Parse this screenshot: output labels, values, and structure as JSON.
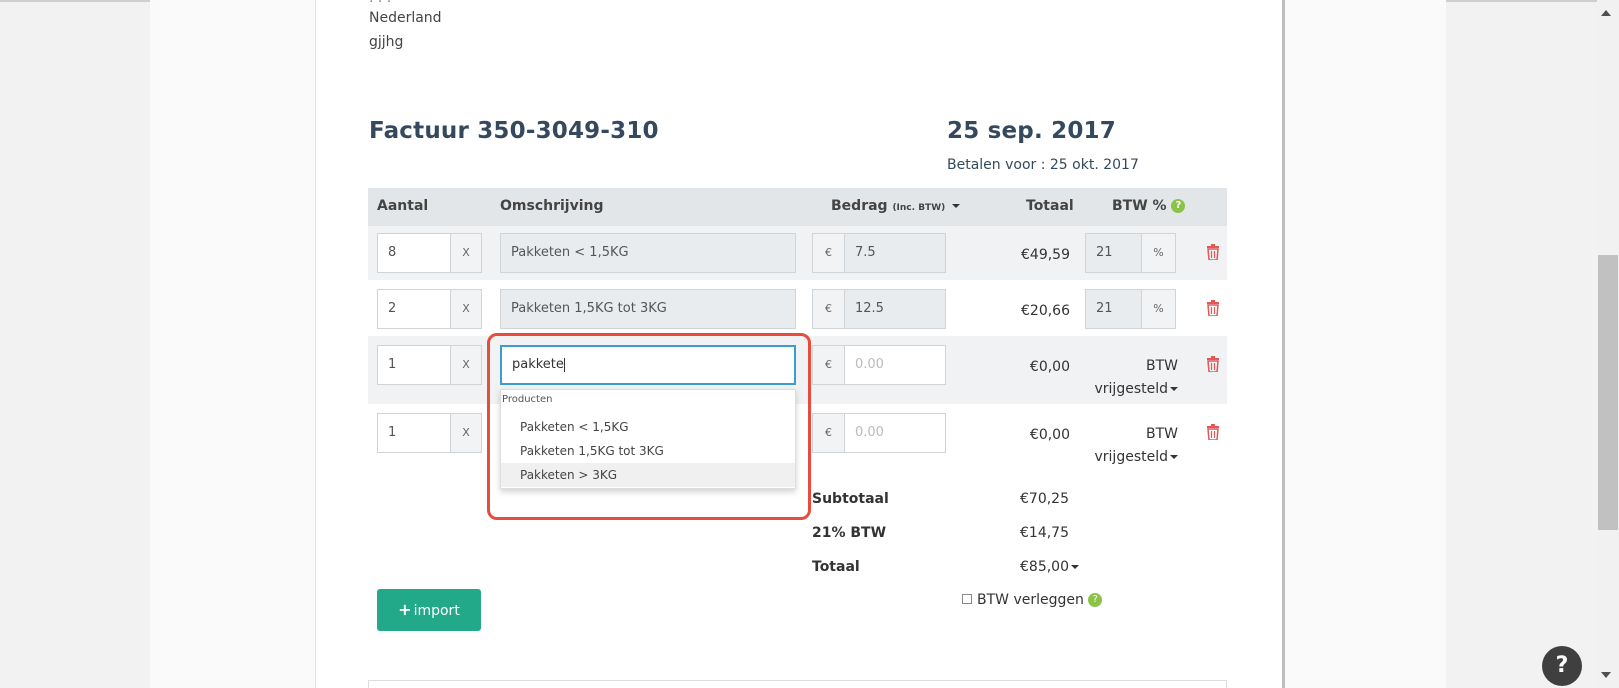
{
  "address": {
    "country": "Nederland",
    "extra": "gjjhg"
  },
  "invoice": {
    "title": "Factuur 350-3049-310",
    "date": "25 sep. 2017",
    "due": "Betalen voor : 25 okt. 2017"
  },
  "table": {
    "headers": {
      "aantal": "Aantal",
      "omschrijving": "Omschrijving",
      "bedrag": "Bedrag",
      "bedrag_note": "(Inc. BTW)",
      "totaal": "Totaal",
      "btw": "BTW %",
      "help": "?"
    },
    "x_label": "X",
    "euro": "€",
    "percent": "%",
    "rows": [
      {
        "qty": "8",
        "desc": "Pakketen < 1,5KG",
        "amount": "7.5",
        "total": "€49,59",
        "btw": "21"
      },
      {
        "qty": "2",
        "desc": "Pakketen 1,5KG tot 3KG",
        "amount": "12.5",
        "total": "€20,66",
        "btw": "21"
      },
      {
        "qty": "1",
        "desc": "pakkete",
        "amount_placeholder": "0.00",
        "total": "€0,00",
        "btw_line1": "BTW",
        "btw_line2": "vrijgesteld"
      },
      {
        "qty": "1",
        "amount_placeholder": "0.00",
        "total": "€0,00",
        "btw_line1": "BTW",
        "btw_line2": "vrijgesteld"
      }
    ]
  },
  "autocomplete": {
    "group": "Producten",
    "items": [
      "Pakketen < 1,5KG",
      "Pakketen 1,5KG tot 3KG",
      "Pakketen > 3KG"
    ]
  },
  "summary": {
    "subtotal_label": "Subtotaal",
    "subtotal": "€70,25",
    "vat_label": "21% BTW",
    "vat": "€14,75",
    "total_label": "Totaal",
    "total": "€85,00"
  },
  "actions": {
    "import_plus": "+",
    "import_label": "import",
    "reverse_vat_label": "BTW verleggen",
    "help": "?"
  },
  "colors": {
    "accent": "#22a98a",
    "highlight": "#e74c3c",
    "focus": "#3a9bd5",
    "delete": "#e45757",
    "help": "#8bc34a"
  }
}
